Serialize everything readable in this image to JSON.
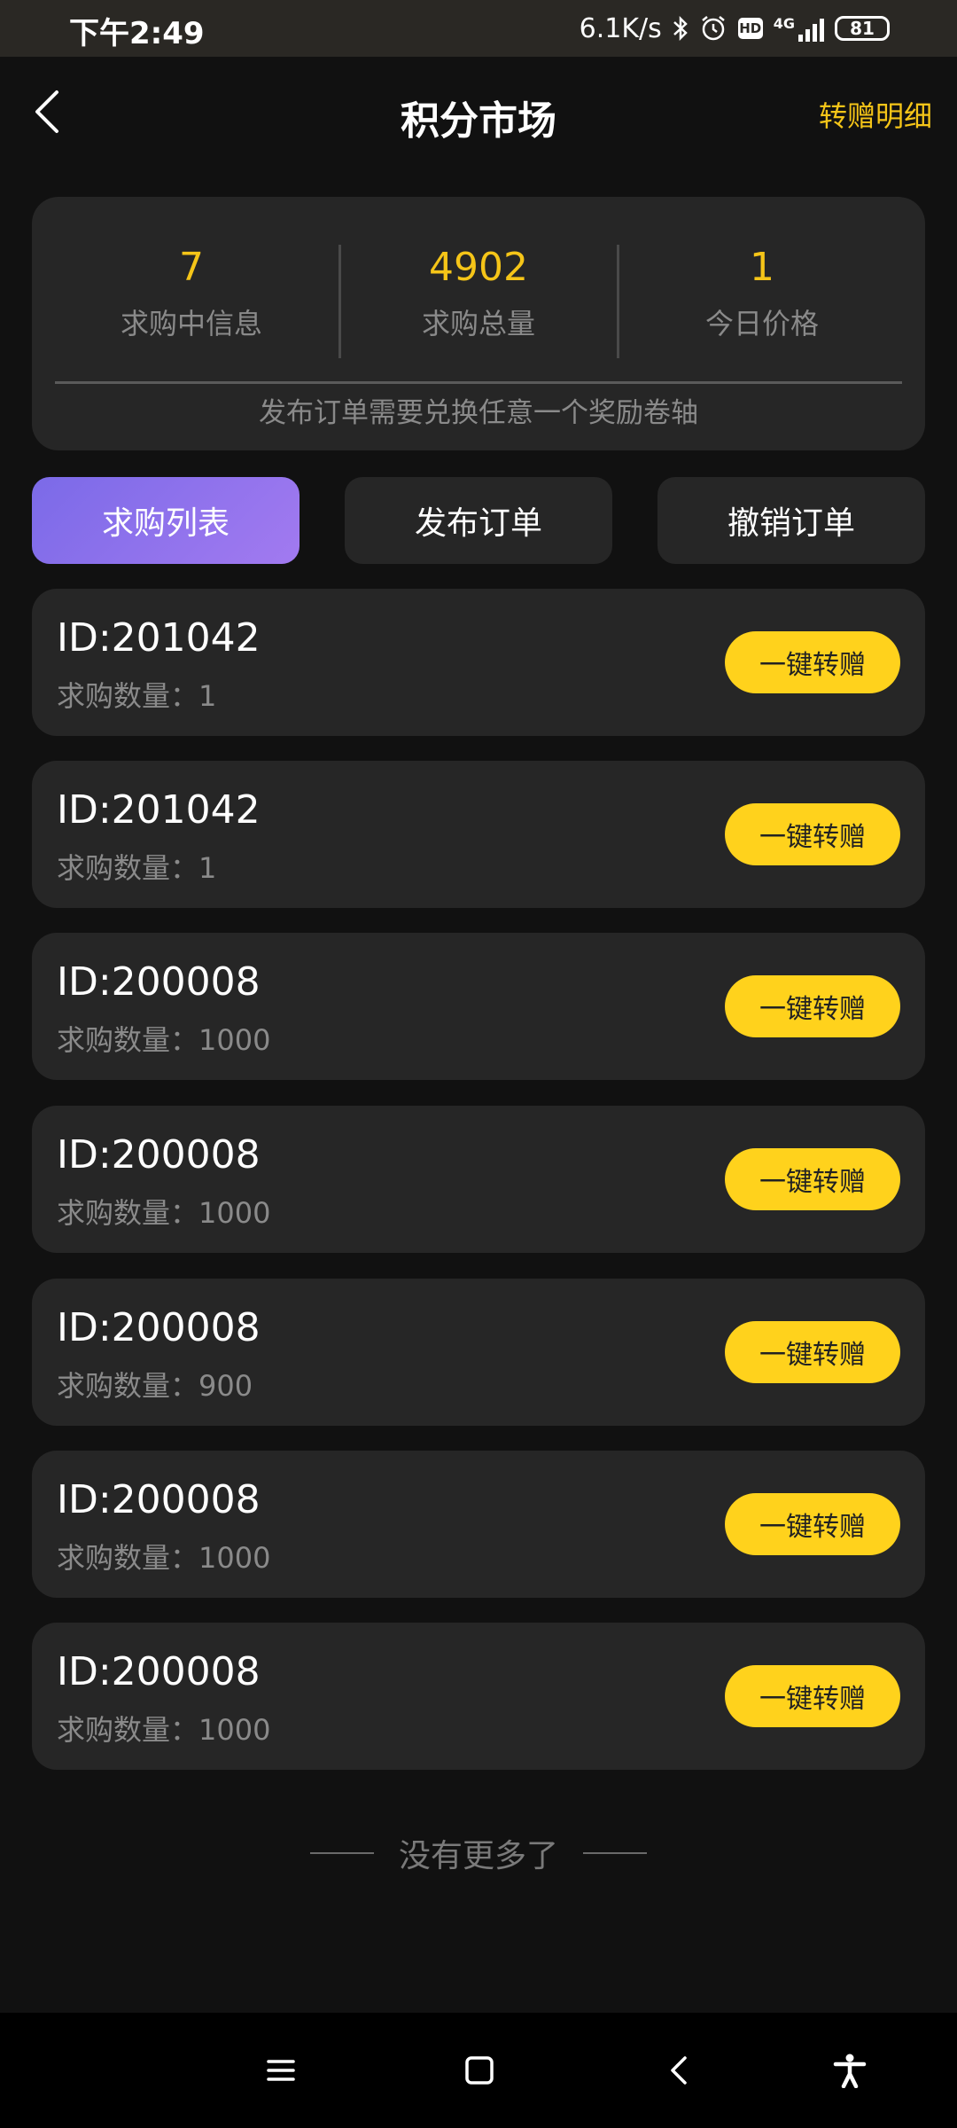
{
  "status_bar": {
    "time": "下午2:49",
    "net_speed": "6.1K/s",
    "hd_label": "HD",
    "network_type": "4G",
    "battery": "81"
  },
  "header": {
    "title": "积分市场",
    "right_link": "转赠明细"
  },
  "stats": {
    "items": [
      {
        "value": "7",
        "label": "求购中信息"
      },
      {
        "value": "4902",
        "label": "求购总量"
      },
      {
        "value": "1",
        "label": "今日价格"
      }
    ],
    "note": "发布订单需要兑换任意一个奖励卷轴"
  },
  "tabs": [
    {
      "label": "求购列表",
      "active": true
    },
    {
      "label": "发布订单",
      "active": false
    },
    {
      "label": "撤销订单",
      "active": false
    }
  ],
  "orders": [
    {
      "id": "ID:201042",
      "qty": "求购数量：1",
      "button": "一键转赠"
    },
    {
      "id": "ID:201042",
      "qty": "求购数量：1",
      "button": "一键转赠"
    },
    {
      "id": "ID:200008",
      "qty": "求购数量：1000",
      "button": "一键转赠"
    },
    {
      "id": "ID:200008",
      "qty": "求购数量：1000",
      "button": "一键转赠"
    },
    {
      "id": "ID:200008",
      "qty": "求购数量：900",
      "button": "一键转赠"
    },
    {
      "id": "ID:200008",
      "qty": "求购数量：1000",
      "button": "一键转赠"
    },
    {
      "id": "ID:200008",
      "qty": "求购数量：1000",
      "button": "一键转赠"
    }
  ],
  "end_text": "没有更多了",
  "colors": {
    "accent": "#f5c518",
    "button": "#ffd21c",
    "active_tab_start": "#7b6ae8",
    "active_tab_end": "#a27af0",
    "card": "#262626",
    "background": "#111111"
  },
  "icons": {
    "back": "chevron-left-icon",
    "bottom_nav": [
      "menu-icon",
      "home-square-icon",
      "back-chevron-icon",
      "accessibility-icon"
    ]
  }
}
